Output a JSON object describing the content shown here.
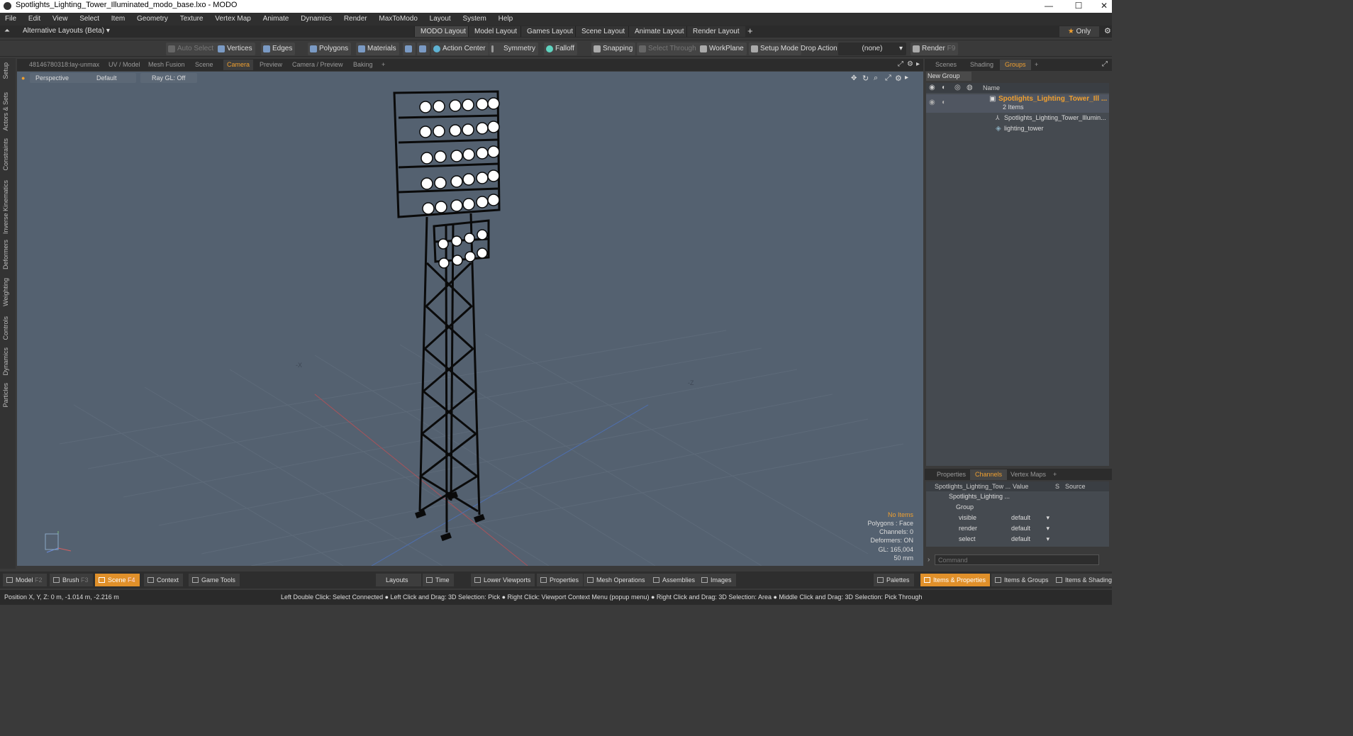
{
  "window": {
    "title": "Spotlights_Lighting_Tower_Illuminated_modo_base.lxo - MODO",
    "minimize": "—",
    "maximize": "☐",
    "close": "✕"
  },
  "menu": [
    "File",
    "Edit",
    "View",
    "Select",
    "Item",
    "Geometry",
    "Texture",
    "Vertex Map",
    "Animate",
    "Dynamics",
    "Render",
    "MaxToModo",
    "Layout",
    "System",
    "Help"
  ],
  "layout": {
    "alt": "Alternative Layouts (Beta)",
    "tabs": [
      "MODO Layout",
      "Model Layout",
      "Games Layout",
      "Scene Layout",
      "Animate Layout",
      "Render Layout"
    ],
    "add": "+",
    "only": "Only"
  },
  "toolbar": {
    "auto_select": "Auto Select",
    "vertices": "Vertices",
    "edges": "Edges",
    "polygons": "Polygons",
    "materials": "Materials",
    "action_center": "Action Center",
    "symmetry": "Symmetry",
    "falloff": "Falloff",
    "snapping": "Snapping",
    "select_through": "Select Through",
    "workplane": "WorkPlane",
    "setup_mode": "Setup Mode",
    "drop_action": "Drop Action",
    "drop_value": "(none)",
    "render": "Render",
    "render_key": "F9"
  },
  "left_tabs": [
    "Setup",
    "Actors & Sets",
    "Constraints",
    "Inverse Kinematics",
    "Deformers",
    "Weighting",
    "Controls",
    "Dynamics",
    "Particles"
  ],
  "viewport_tabs": [
    "48146780318:lay-unmax",
    "UV / Model",
    "Mesh Fusion",
    "Scene",
    "Camera",
    "Preview",
    "Camera / Preview",
    "Baking",
    "+"
  ],
  "viewport": {
    "view": "Perspective",
    "shading": "Default",
    "raygl": "Ray GL: Off",
    "axis_x": "-X",
    "axis_z": "-Z",
    "stats": {
      "items": "No Items",
      "polygons": "Polygons : Face",
      "channels": "Channels: 0",
      "deformers": "Deformers: ON",
      "gl": "GL: 165,004",
      "lens": "50 mm"
    }
  },
  "right_tabs": [
    "Scenes",
    "Shading",
    "Groups",
    "+"
  ],
  "groups": {
    "new_group": "New Group",
    "col_name": "Name",
    "root": "Spotlights_Lighting_Tower_Ill ...",
    "root_count": "2 Items",
    "children": [
      "Spotlights_Lighting_Tower_Illumin...",
      "lighting_tower"
    ]
  },
  "props_tabs": [
    "Properties",
    "Channels",
    "Vertex Maps",
    "+"
  ],
  "channels": {
    "col_item": "Spotlights_Lighting_Tow ...",
    "col_value": "Value",
    "col_s": "S",
    "col_source": "Source",
    "item": "Spotlights_Lighting ...",
    "group": "Group",
    "rows": [
      {
        "name": "visible",
        "value": "default"
      },
      {
        "name": "render",
        "value": "default"
      },
      {
        "name": "select",
        "value": "default"
      }
    ]
  },
  "command_placeholder": "Command",
  "bottom": {
    "model": "Model",
    "model_key": "F2",
    "brush": "Brush",
    "brush_key": "F3",
    "scene": "Scene",
    "scene_key": "F4",
    "context": "Context",
    "game_tools": "Game Tools",
    "layouts": "Layouts",
    "time": "Time",
    "lower_viewports": "Lower Viewports",
    "properties": "Properties",
    "mesh_ops": "Mesh Operations",
    "assemblies": "Assemblies",
    "images": "Images",
    "palettes": "Palettes",
    "items_props": "Items & Properties",
    "items_groups": "Items & Groups",
    "items_shading": "Items & Shading"
  },
  "status": {
    "position": "Position X, Y, Z:  0 m, -1.014 m, -2.216 m",
    "hints": "Left Double Click: Select Connected ● Left Click and Drag: 3D Selection: Pick ● Right Click: Viewport Context Menu (popup menu) ● Right Click and Drag: 3D Selection: Area ● Middle Click and Drag: 3D Selection: Pick Through"
  },
  "colors": {
    "accent": "#f0a030",
    "viewport_bg": "#546170",
    "panel_bg": "#3a3a3a"
  }
}
